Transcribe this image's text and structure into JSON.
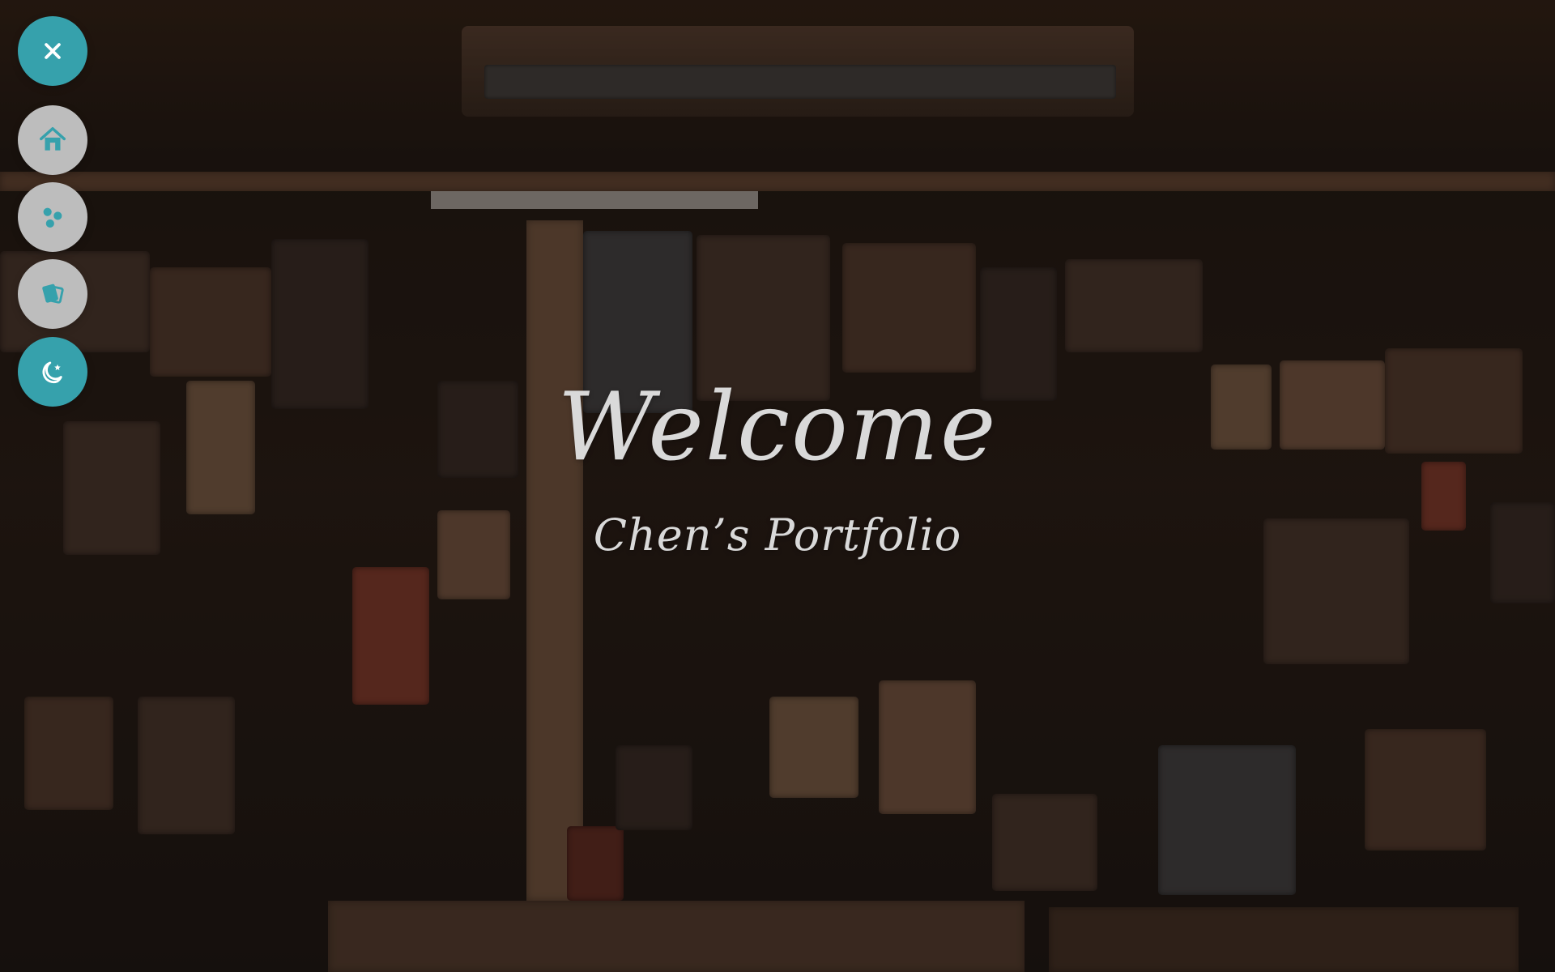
{
  "hero": {
    "title": "Welcome",
    "subtitle": "Chen’s Portfolio"
  },
  "dock": {
    "items": [
      {
        "name": "close",
        "icon": "close-icon"
      },
      {
        "name": "home",
        "icon": "home-icon"
      },
      {
        "name": "share",
        "icon": "share-icon"
      },
      {
        "name": "card",
        "icon": "card-icon"
      },
      {
        "name": "theme",
        "icon": "moon-star-icon"
      }
    ]
  },
  "colors": {
    "accent": "#36A1AC",
    "neutral_button": "#BDBDBD",
    "text": "#D9D9D9"
  }
}
